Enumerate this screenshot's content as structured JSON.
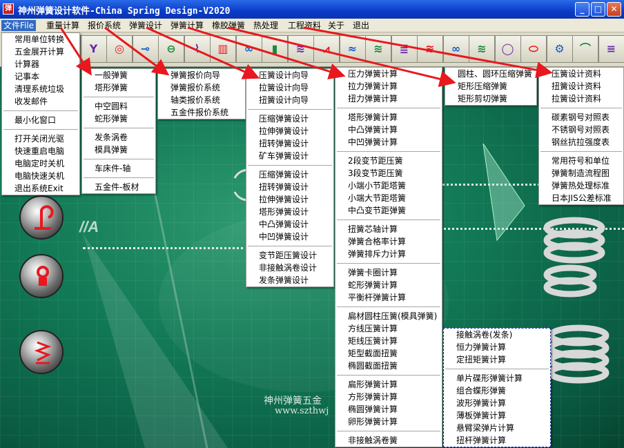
{
  "window": {
    "title": "神州弹簧设计软件-China Spring Design-V2020",
    "icon": "app-logo-icon"
  },
  "menubar": [
    "文件File",
    "重量计算",
    "报价系统",
    "弹簧设计",
    "弹簧计算",
    "橡胶弹簧",
    "热处理",
    "工程资料",
    "关于",
    "退出"
  ],
  "toolbar": {
    "icons": [
      "spring-design-icon",
      "spring-calc-icon",
      "rubber-spring-icon",
      "x-y-plot-icon",
      "bearing-icon",
      "shaft-icon",
      "chain-icon",
      "compression-spring-icon",
      "coil-array-icon",
      "ring-icon",
      "battery-icon",
      "stack-icon",
      "zigzag-icon",
      "wave-spring-icon",
      "spring-red-icon",
      "blue-coil-icon",
      "green-coil-icon",
      "spiral-icon",
      "blue-spring-icon",
      "ring-red-icon",
      "oval-icon",
      "gear-icon",
      "arch-icon",
      "coil-grey-icon"
    ]
  },
  "menus": {
    "file": [
      "常用单位转换",
      "五金展开计算",
      "计算器",
      "记事本",
      "清理系统垃圾",
      "收发邮件",
      "—",
      "最小化窗口",
      "—",
      "打开关闭光驱",
      "快速重启电脑",
      "电脑定时关机",
      "电脑快速关机",
      "退出系统Exit"
    ],
    "weight": [
      "一般弹簧",
      "塔形弹簧",
      "—",
      "中空圆料",
      "蛇形弹簧",
      "—",
      "发条涡卷",
      "模具弹簧",
      "—",
      "车床件-轴",
      "—",
      "五金件-板材"
    ],
    "quote": [
      "弹簧报价向导",
      "弹簧报价系统",
      "轴类报价系统",
      "五金件报价系统"
    ],
    "design": [
      "压簧设计向导",
      "拉簧设计向导",
      "扭簧设计向导",
      "—",
      "压缩弹簧设计",
      "拉伸弹簧设计",
      "扭转弹簧设计",
      "矿车弹簧设计",
      "—",
      "压缩弹簧设计",
      "扭转弹簧设计",
      "拉伸弹簧设计",
      "塔形弹簧设计",
      "中凸弹簧设计",
      "中凹弹簧设计",
      "—",
      "变节距压簧设计",
      "非接触涡卷设计",
      "发条弹簧设计"
    ],
    "calc": [
      "压力弹簧计算",
      "拉力弹簧计算",
      "扭力弹簧计算",
      "—",
      "塔形弹簧计算",
      "中凸弹簧计算",
      "中凹弹簧计算",
      "—",
      "2段变节距压簧",
      "3段变节距压簧",
      "小端小节距塔簧",
      "小端大节距塔簧",
      "中凸变节距弹簧",
      "—",
      "扭簧芯轴计算",
      "弹簧合格率计算",
      "弹簧排斥力计算",
      "—",
      "弹簧卡圈计算",
      "蛇形弹簧计算",
      "平衡杆弹簧计算",
      "—",
      "扁材圆柱压簧(模具弹簧)",
      "方线压簧计算",
      "矩线压簧计算",
      "矩型截面扭簧",
      "椭圆截面扭簧",
      "—",
      "扁形弹簧计算",
      "方形弹簧计算",
      "椭圆弹簧计算",
      "卵形弹簧计算",
      "—",
      "非接触涡卷簧"
    ],
    "rubber": [
      "圆柱、圆环压缩弹簧",
      "矩形压缩弹簧",
      "矩形剪切弹簧"
    ],
    "calc_sub": [
      "接触涡卷(发条)",
      "恒力弹簧计算",
      "定扭矩簧计算",
      "—",
      "单片碟形弹簧计算",
      "组合蝶形弹簧",
      "波形弹簧计算",
      "薄板弹簧计算",
      "悬臂梁弹片计算",
      "扭杆弹簧计算"
    ],
    "engineering": [
      "压簧设计资料",
      "扭簧设计资料",
      "拉簧设计资料",
      "—",
      "碳素钢号对照表",
      "不锈钢号对照表",
      "钢丝抗拉强度表",
      "—",
      "常用符号和单位",
      "弹簧制造流程图",
      "弹簧热处理标准",
      "日本JIS公差标准"
    ]
  },
  "watermark": {
    "company": "神州弹簧五金",
    "url": "www.szthwj"
  },
  "colors": {
    "titlebar": "#0a3cc8",
    "menu_active": "#316ac5",
    "arrow": "#e8181e",
    "background": "#127a56"
  }
}
